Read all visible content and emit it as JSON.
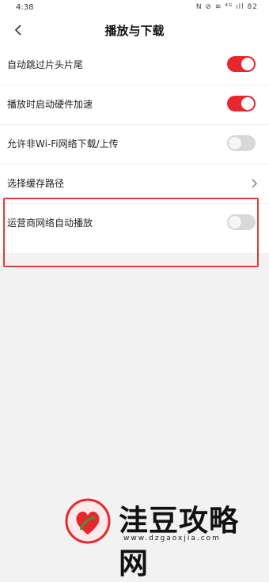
{
  "status_bar": {
    "time": "4:38",
    "icons_text": "N ⊘ ≋ ⁴ᴳ ıll 82"
  },
  "header": {
    "title": "播放与下载"
  },
  "settings": [
    {
      "label": "自动跳过片头片尾",
      "control": "toggle",
      "state": "on"
    },
    {
      "label": "播放时启动硬件加速",
      "control": "toggle",
      "state": "on"
    },
    {
      "label": "允许非Wi-Fi网络下载/上传",
      "control": "toggle",
      "state": "off"
    },
    {
      "label": "选择缓存路径",
      "control": "chevron"
    },
    {
      "label": "运营商网络自动播放",
      "control": "toggle",
      "state": "off"
    }
  ],
  "colors": {
    "accent": "#e8262d",
    "highlight": "#e13b3b"
  },
  "watermark": {
    "text": "洼豆攻略网",
    "url": "www.dzgaoxjia.com"
  }
}
